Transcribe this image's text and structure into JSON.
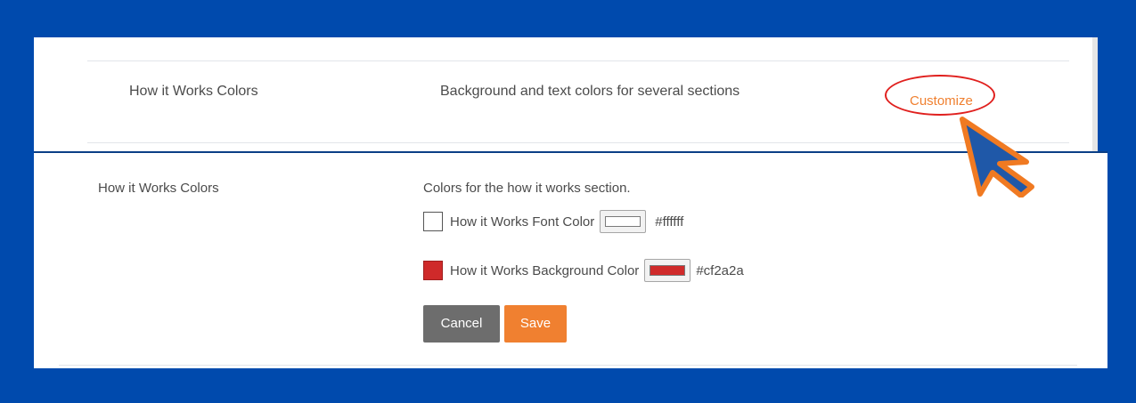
{
  "setting_row": {
    "label": "How it Works Colors",
    "description": "Background and text colors for several sections",
    "customize_link": "Customize"
  },
  "editor": {
    "label": "How it Works Colors",
    "description": "Colors for the how it works section.",
    "font_color": {
      "label": "How it Works Font Color",
      "hex": "#ffffff",
      "color": "#ffffff"
    },
    "background_color": {
      "label": "How it Works Background Color",
      "hex": "#cf2a2a",
      "color": "#cf2a2a"
    },
    "cancel_label": "Cancel",
    "save_label": "Save"
  },
  "colors": {
    "accent": "#f08030",
    "frame": "#004aad",
    "highlight": "#e0201e"
  },
  "icons": {
    "pointer": "cursor-arrow-icon"
  }
}
